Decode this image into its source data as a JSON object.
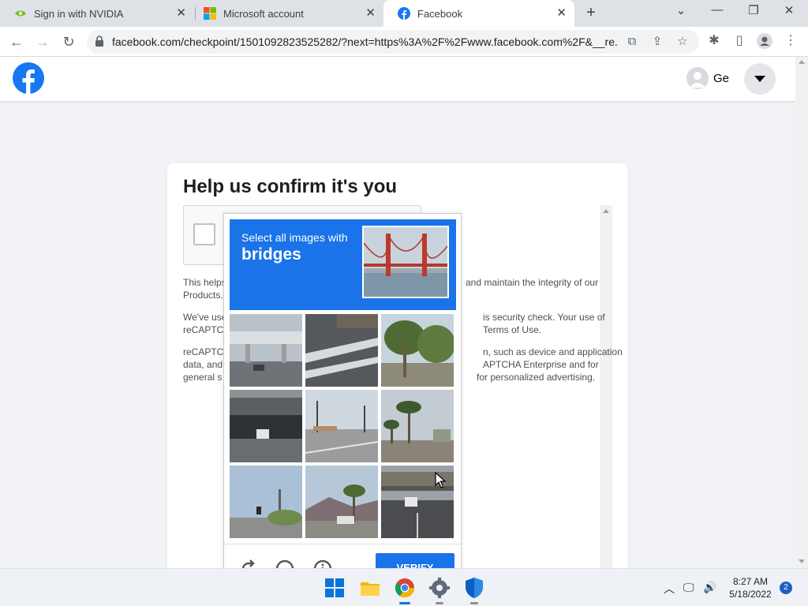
{
  "browser": {
    "tabs": [
      {
        "title": "Sign in with NVIDIA",
        "icon": "nvidia-icon",
        "active": false
      },
      {
        "title": "Microsoft account",
        "icon": "microsoft-icon",
        "active": false
      },
      {
        "title": "Facebook",
        "icon": "facebook-icon",
        "active": true
      }
    ],
    "url": "facebook.com/checkpoint/1501092823525282/?next=https%3A%2F%2Fwww.facebook.com%2F&__re..."
  },
  "header": {
    "profile_name": "Ge",
    "brand_color": "#1877f2"
  },
  "card": {
    "title": "Help us confirm it's you",
    "paragraph1_visible": "This helps",
    "paragraph1_end": "and maintain the integrity of our",
    "paragraph1_line2": "Products.",
    "paragraph2_start": "We've use",
    "paragraph2_end": "is security check. Your use of",
    "paragraph2_line2_start": "reCAPTC",
    "paragraph2_line2_end": "Terms of Use.",
    "paragraph3_start": "reCAPTC",
    "paragraph3_end": "n, such as device and application",
    "paragraph3_line2_start": "data, and",
    "paragraph3_line2_end": "APTCHA Enterprise and for",
    "paragraph3_line3_start": "general s",
    "paragraph3_line3_end": "for personalized advertising."
  },
  "challenge": {
    "instruction": "Select all images with",
    "target": "bridges",
    "verify_label": "VERIFY",
    "accent": "#1a73e8"
  },
  "taskbar": {
    "time": "8:27 AM",
    "date": "5/18/2022",
    "notifications": "2"
  }
}
